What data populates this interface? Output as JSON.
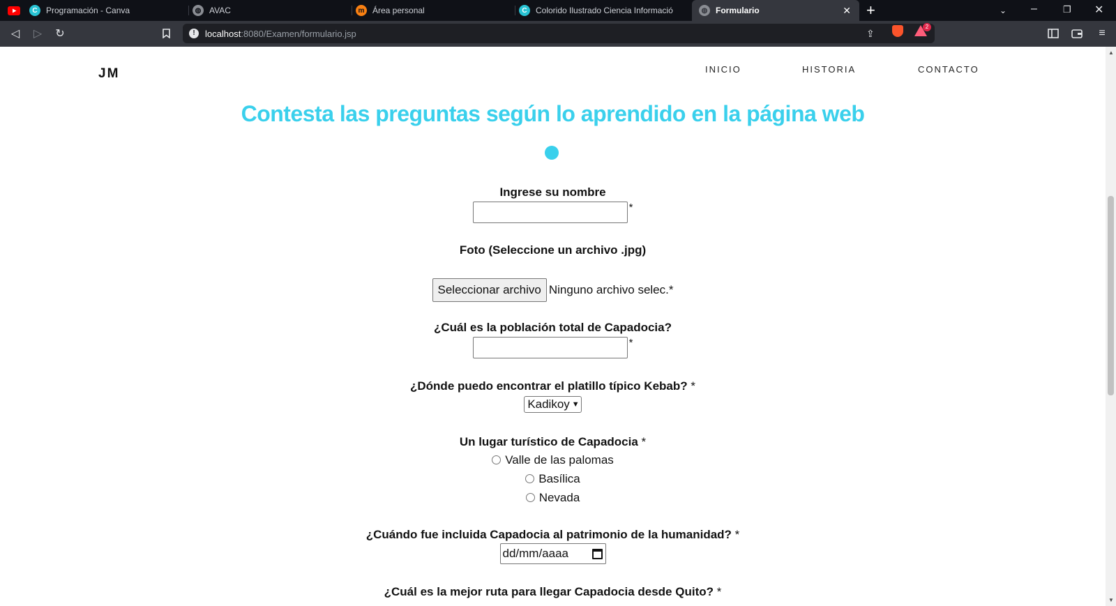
{
  "browser": {
    "tabs": [
      {
        "title": "Programación - Canva",
        "icon": "canva-icon"
      },
      {
        "title": "AVAC",
        "icon": "globe-icon"
      },
      {
        "title": "Área personal",
        "icon": "moodle-icon"
      },
      {
        "title": "Colorido Ilustrado Ciencia Informació",
        "icon": "canva-icon"
      },
      {
        "title": "Formulario",
        "icon": "globe-icon"
      }
    ],
    "new_tab_label": "+",
    "address": {
      "host": "localhost",
      "rest": ":8080/Examen/formulario.jsp"
    },
    "rewards_count": "2"
  },
  "page": {
    "logo": "JM",
    "nav": [
      "INICIO",
      "HISTORIA",
      "CONTACTO"
    ],
    "heading": "Contesta las preguntas según lo aprendido en la página web",
    "accent_color": "#3ad0ec",
    "form": {
      "name_label": "Ingrese su nombre",
      "name_value": "",
      "required_mark": "*",
      "photo_label": "Foto (Seleccione un archivo .jpg)",
      "file_button": "Seleccionar archivo",
      "file_status": "Ninguno archivo selec.*",
      "population_label": "¿Cuál es la población total de Capadocia?",
      "population_value": "",
      "kebab_label": "¿Dónde puedo encontrar el platillo típico Kebab?",
      "kebab_selected": "Kadikoy",
      "tourist_label": "Un lugar turístico de Capadocia",
      "tourist_options": [
        "Valle de las palomas",
        "Basílica",
        "Nevada"
      ],
      "heritage_label": "¿Cuándo fue incluida Capadocia al patrimonio de la humanidad?",
      "heritage_placeholder": "dd/mm/aaaa",
      "route_label": "¿Cuál es la mejor ruta para llegar Capadocia desde Quito?"
    }
  }
}
